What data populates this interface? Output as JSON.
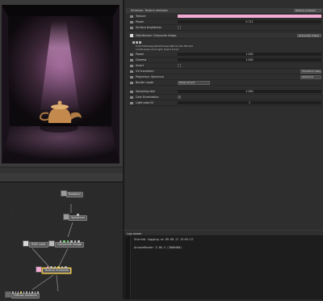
{
  "viewport": {
    "status_text": ""
  },
  "inspector": {
    "title": "Emission: Texture emission",
    "title_dropdown": "Texture emission",
    "rows": [
      {
        "label": "Texture",
        "value": "",
        "kind": "color",
        "color": "#f2a9d3"
      },
      {
        "label": "Power",
        "value": "0.711",
        "kind": "slider"
      },
      {
        "label": "Surface brightness",
        "value": "",
        "kind": "check"
      },
      {
        "label": "Distribution: Greyscale image",
        "value": "Greyscale image",
        "kind": "header"
      },
      {
        "label": "Power",
        "value": "1.000",
        "kind": "slider"
      },
      {
        "label": "Gamma",
        "value": "1.000",
        "kind": "slider"
      },
      {
        "label": "Invert",
        "value": "",
        "kind": "check"
      },
      {
        "label": "UV transform",
        "value": "Transform value",
        "kind": "dropdown"
      },
      {
        "label": "Projection: Spherical",
        "value": "Spherical",
        "kind": "dropdown"
      },
      {
        "label": "Border mode",
        "value": "Wrap around",
        "kind": "dropdown-inline"
      },
      {
        "label": "Sampling rate",
        "value": "1.000",
        "kind": "slider"
      },
      {
        "label": "Cast illumination",
        "value": "✓",
        "kind": "check"
      },
      {
        "label": "Light pass ID",
        "value": "1",
        "kind": "slider"
      }
    ],
    "image_info_1": "F:\\OCTOPUS\\wip\\3832511\\lens\\IRF-01 500 FPS 001",
    "image_info_2": "1x128 pixels, 8-bit light, Type E 16 bit"
  },
  "node_graph": {
    "nodes": [
      {
        "label": "Rotation"
      },
      {
        "label": "Spherical"
      },
      {
        "label": "RGB color"
      },
      {
        "label": "Greyscale image"
      },
      {
        "label": "Texture emission"
      },
      {
        "label": "Diffuse material"
      }
    ]
  },
  "log": {
    "title": "Log viewer",
    "lines": [
      "Started logging on 09.09.17 13:01:17",
      "",
      "OctaneRender 3.06.4 (3060400)"
    ]
  },
  "colors": {
    "accent_pink": "#f2a9d3",
    "panel": "#2e2e2e",
    "selected_node": "#e6c86a"
  }
}
